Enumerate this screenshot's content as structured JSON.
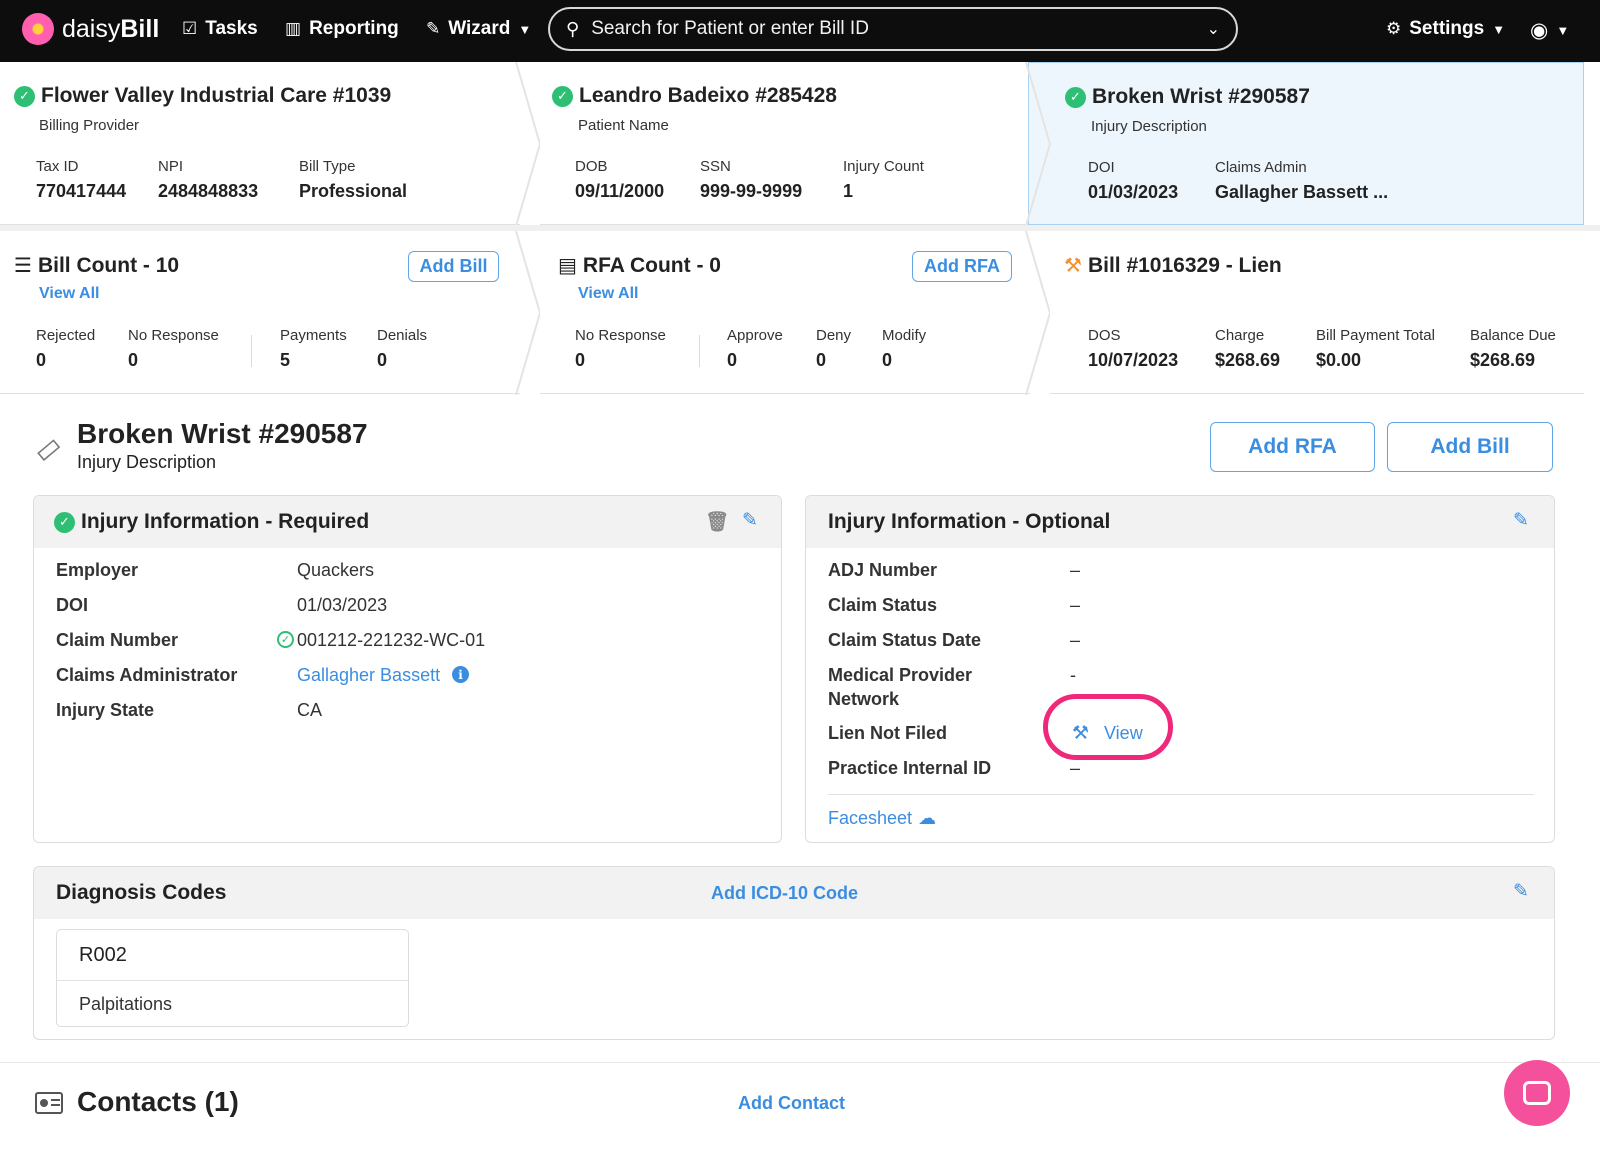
{
  "nav": {
    "brand_pre": "daisy",
    "brand_bold": "Bill",
    "tasks": "Tasks",
    "reporting": "Reporting",
    "wizard": "Wizard",
    "search_placeholder": "Search for Patient or enter Bill ID",
    "settings": "Settings"
  },
  "provider": {
    "title": "Flower Valley Industrial Care #1039",
    "subtitle": "Billing Provider",
    "fields": [
      {
        "label": "Tax ID",
        "value": "770417444"
      },
      {
        "label": "NPI",
        "value": "2484848833"
      },
      {
        "label": "Bill Type",
        "value": "Professional"
      }
    ]
  },
  "patient": {
    "title": "Leandro Badeixo #285428",
    "subtitle": "Patient Name",
    "fields": [
      {
        "label": "DOB",
        "value": "09/11/2000"
      },
      {
        "label": "SSN",
        "value": "999-99-9999"
      },
      {
        "label": "Injury Count",
        "value": "1"
      }
    ]
  },
  "injury_card": {
    "title": "Broken Wrist #290587",
    "subtitle": "Injury Description",
    "fields": [
      {
        "label": "DOI",
        "value": "01/03/2023"
      },
      {
        "label": "Claims Admin",
        "value": "Gallagher Bassett ..."
      }
    ]
  },
  "bills": {
    "title": "Bill Count - 10",
    "view_all": "View All",
    "add_label": "Add Bill",
    "fields": [
      {
        "label": "Rejected",
        "value": "0"
      },
      {
        "label": "No Response",
        "value": "0"
      },
      {
        "label": "Payments",
        "value": "5"
      },
      {
        "label": "Denials",
        "value": "0"
      }
    ]
  },
  "rfas": {
    "title": "RFA Count - 0",
    "view_all": "View All",
    "add_label": "Add RFA",
    "fields": [
      {
        "label": "No Response",
        "value": "0"
      },
      {
        "label": "Approve",
        "value": "0"
      },
      {
        "label": "Deny",
        "value": "0"
      },
      {
        "label": "Modify",
        "value": "0"
      }
    ]
  },
  "bill_card": {
    "title": "Bill #1016329 - Lien",
    "fields": [
      {
        "label": "DOS",
        "value": "10/07/2023"
      },
      {
        "label": "Charge",
        "value": "$268.69"
      },
      {
        "label": "Bill Payment Total",
        "value": "$0.00"
      },
      {
        "label": "Balance Due",
        "value": "$268.69"
      }
    ]
  },
  "section": {
    "title": "Broken Wrist #290587",
    "subtitle": "Injury Description",
    "add_rfa": "Add RFA",
    "add_bill": "Add Bill"
  },
  "required": {
    "title": "Injury Information - Required",
    "rows": [
      {
        "k": "Employer",
        "v": "Quackers"
      },
      {
        "k": "DOI",
        "v": "01/03/2023"
      },
      {
        "k": "Claim Number",
        "v": "001212-221232-WC-01"
      },
      {
        "k": "Claims Administrator",
        "v": "Gallagher Bassett"
      },
      {
        "k": "Injury State",
        "v": "CA"
      }
    ]
  },
  "optional": {
    "title": "Injury Information - Optional",
    "rows": [
      {
        "k": "ADJ Number",
        "v": "–"
      },
      {
        "k": "Claim Status",
        "v": "–"
      },
      {
        "k": "Claim Status Date",
        "v": "–"
      },
      {
        "k": "Medical Provider",
        "k2": "Network",
        "v": "-"
      },
      {
        "k": "Lien Not Filed",
        "v": "View"
      },
      {
        "k": "Practice Internal ID",
        "v": "–"
      }
    ],
    "facesheet": "Facesheet"
  },
  "diagnosis": {
    "title": "Diagnosis Codes",
    "add_label": "Add ICD-10 Code",
    "code": "R002",
    "description": "Palpitations"
  },
  "contacts": {
    "title": "Contacts (1)",
    "add_label": "Add Contact"
  },
  "colors": {
    "accent": "#3b8de0",
    "success": "#2fbf74",
    "highlight": "#f0287a",
    "lien": "#f5922b",
    "fab": "#f5509c"
  }
}
